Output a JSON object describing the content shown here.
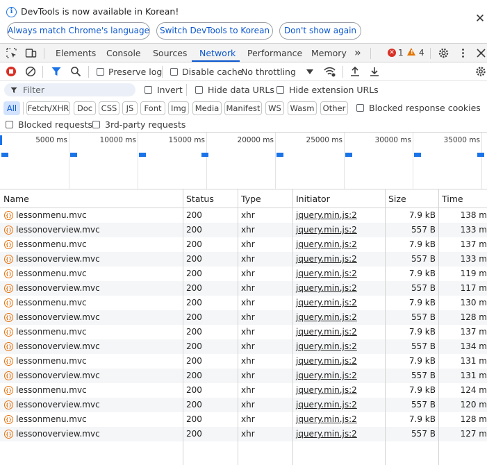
{
  "infobar": {
    "message": "DevTools is now available in Korean!",
    "buttons": [
      "Always match Chrome's language",
      "Switch DevTools to Korean",
      "Don't show again"
    ],
    "close_glyph": "✕"
  },
  "tabs": [
    "Elements",
    "Console",
    "Sources",
    "Network",
    "Performance",
    "Memory"
  ],
  "active_tab": "Network",
  "overflow_glyph": "»",
  "error_count": "1",
  "warning_count": "4",
  "toolbar": {
    "preserve_log": "Preserve log",
    "disable_cache": "Disable cache",
    "throttling": "No throttling"
  },
  "filter": {
    "placeholder": "Filter",
    "invert": "Invert",
    "hide_data_urls": "Hide data URLs",
    "hide_extension_urls": "Hide extension URLs"
  },
  "types": [
    "All",
    "Fetch/XHR",
    "Doc",
    "CSS",
    "JS",
    "Font",
    "Img",
    "Media",
    "Manifest",
    "WS",
    "Wasm",
    "Other"
  ],
  "active_type": "All",
  "blocked_response_cookies": "Blocked response cookies",
  "blocked_requests": "Blocked requests",
  "third_party_requests": "3rd-party requests",
  "timeline_ticks": [
    "5000 ms",
    "10000 ms",
    "15000 ms",
    "20000 ms",
    "25000 ms",
    "30000 ms",
    "35000 ms"
  ],
  "columns": [
    "Name",
    "Status",
    "Type",
    "Initiator",
    "Size",
    "Time"
  ],
  "requests": [
    {
      "name": "lessonmenu.mvc",
      "status": "200",
      "type": "xhr",
      "initiator": "jquery.min.js:2",
      "size": "7.9 kB",
      "time": "138 m"
    },
    {
      "name": "lessonoverview.mvc",
      "status": "200",
      "type": "xhr",
      "initiator": "jquery.min.js:2",
      "size": "557 B",
      "time": "133 m"
    },
    {
      "name": "lessonmenu.mvc",
      "status": "200",
      "type": "xhr",
      "initiator": "jquery.min.js:2",
      "size": "7.9 kB",
      "time": "137 m"
    },
    {
      "name": "lessonoverview.mvc",
      "status": "200",
      "type": "xhr",
      "initiator": "jquery.min.js:2",
      "size": "557 B",
      "time": "133 m"
    },
    {
      "name": "lessonmenu.mvc",
      "status": "200",
      "type": "xhr",
      "initiator": "jquery.min.js:2",
      "size": "7.9 kB",
      "time": "119 m"
    },
    {
      "name": "lessonoverview.mvc",
      "status": "200",
      "type": "xhr",
      "initiator": "jquery.min.js:2",
      "size": "557 B",
      "time": "117 m"
    },
    {
      "name": "lessonmenu.mvc",
      "status": "200",
      "type": "xhr",
      "initiator": "jquery.min.js:2",
      "size": "7.9 kB",
      "time": "130 m"
    },
    {
      "name": "lessonoverview.mvc",
      "status": "200",
      "type": "xhr",
      "initiator": "jquery.min.js:2",
      "size": "557 B",
      "time": "128 m"
    },
    {
      "name": "lessonmenu.mvc",
      "status": "200",
      "type": "xhr",
      "initiator": "jquery.min.js:2",
      "size": "7.9 kB",
      "time": "137 m"
    },
    {
      "name": "lessonoverview.mvc",
      "status": "200",
      "type": "xhr",
      "initiator": "jquery.min.js:2",
      "size": "557 B",
      "time": "134 m"
    },
    {
      "name": "lessonmenu.mvc",
      "status": "200",
      "type": "xhr",
      "initiator": "jquery.min.js:2",
      "size": "7.9 kB",
      "time": "131 m"
    },
    {
      "name": "lessonoverview.mvc",
      "status": "200",
      "type": "xhr",
      "initiator": "jquery.min.js:2",
      "size": "557 B",
      "time": "131 m"
    },
    {
      "name": "lessonmenu.mvc",
      "status": "200",
      "type": "xhr",
      "initiator": "jquery.min.js:2",
      "size": "7.9 kB",
      "time": "124 m"
    },
    {
      "name": "lessonoverview.mvc",
      "status": "200",
      "type": "xhr",
      "initiator": "jquery.min.js:2",
      "size": "557 B",
      "time": "120 m"
    },
    {
      "name": "lessonmenu.mvc",
      "status": "200",
      "type": "xhr",
      "initiator": "jquery.min.js:2",
      "size": "7.9 kB",
      "time": "128 m"
    },
    {
      "name": "lessonoverview.mvc",
      "status": "200",
      "type": "xhr",
      "initiator": "jquery.min.js:2",
      "size": "557 B",
      "time": "127 m"
    }
  ],
  "colors": {
    "accent": "#0b57d0",
    "error": "#d93025",
    "warning": "#e37400",
    "xhr_icon": "#e8710a"
  }
}
